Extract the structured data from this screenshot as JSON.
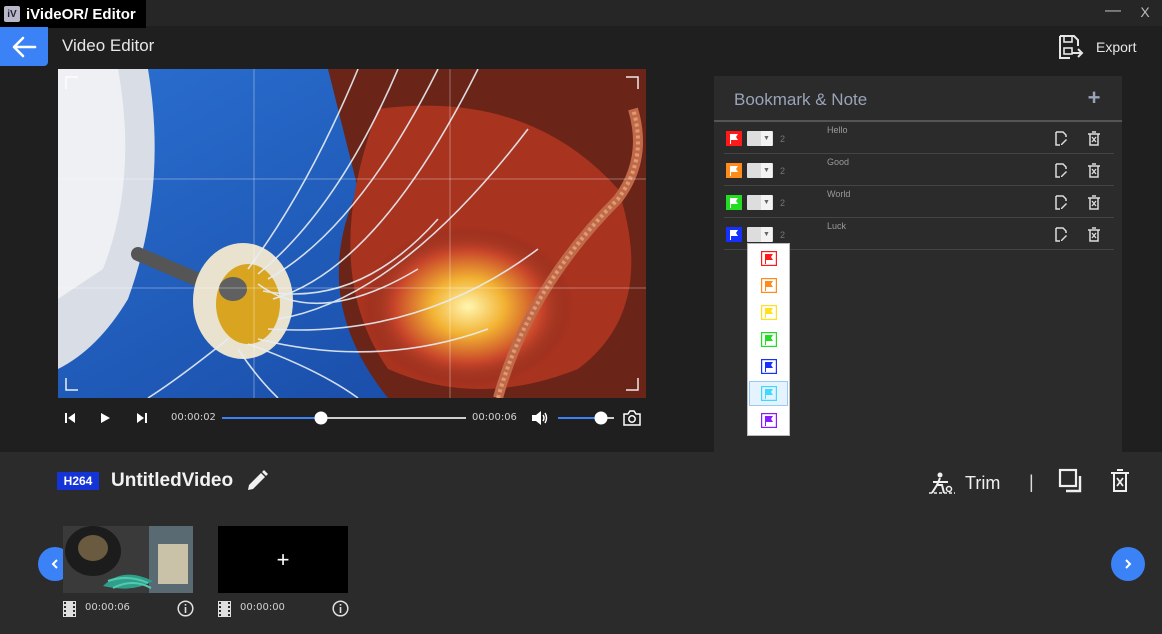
{
  "app": {
    "title": "iVideOR/ Editor",
    "logo_glyph": "iV",
    "window_controls": {
      "minimize": "—",
      "close": "X"
    }
  },
  "header": {
    "page_title": "Video Editor",
    "export_label": "Export",
    "back_icon": "arrow-left-icon"
  },
  "player": {
    "current_time": "00:00:02",
    "total_time": "00:00:06",
    "progress_fraction": 0.4,
    "volume_fraction": 0.85
  },
  "bookmarks": {
    "title": "Bookmark & Note",
    "add_label": "+",
    "rows": [
      {
        "flag_color": "#ff1a1a",
        "count": "2",
        "note": "Hello"
      },
      {
        "flag_color": "#ff8c1a",
        "count": "2",
        "note": "Good"
      },
      {
        "flag_color": "#22dd22",
        "count": "2",
        "note": "World"
      },
      {
        "flag_color": "#1530ff",
        "count": "2",
        "note": "Luck"
      }
    ],
    "dropdown_colors": [
      "#ff1a1a",
      "#ff8c1a",
      "#ffe01a",
      "#22dd22",
      "#1530ff",
      "#40d8ff",
      "#8a1aff"
    ],
    "dropdown_selected_index": 5
  },
  "project": {
    "codec": "H264",
    "name": "UntitledVideo",
    "trim_label": "Trim",
    "separator": "|"
  },
  "clips": [
    {
      "duration": "00:00:06",
      "kind": "video-thumbnail"
    },
    {
      "duration": "00:00:00",
      "kind": "add-placeholder",
      "add_label": "+"
    }
  ],
  "colors": {
    "accent": "#3b82f6",
    "background": "#1f1f1f",
    "panel": "#2b2b2b"
  }
}
